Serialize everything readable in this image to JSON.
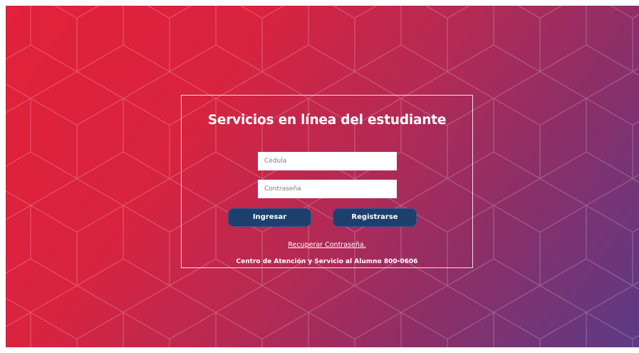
{
  "login": {
    "title": "Servicios en línea del estudiante",
    "cedula_placeholder": "Cédula",
    "password_placeholder": "Contraseña",
    "login_button": "Ingresar",
    "register_button": "Registrarse",
    "recover_link": "Recuperar Contraseña.",
    "footer_text": "Centro de Atención y Servicio al Alumno 800-0606"
  },
  "colors": {
    "gradient_start": "#e2213a",
    "gradient_end": "#5b3a86",
    "button_bg": "#1d3f6e",
    "text": "#ffffff"
  }
}
